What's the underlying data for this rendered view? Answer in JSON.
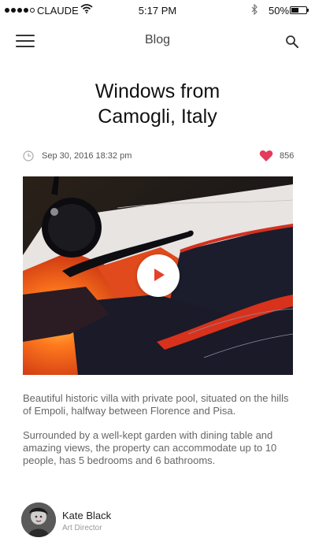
{
  "status_bar": {
    "carrier": "CLAUDE",
    "time": "5:17 PM",
    "battery_percent": "50%",
    "battery_level": 0.5,
    "signal_bars_filled": 4,
    "signal_bars_total": 5,
    "icons": [
      "wifi-icon",
      "bluetooth-icon",
      "battery-icon"
    ]
  },
  "nav": {
    "title": "Blog",
    "menu_icon": "hamburger-menu-icon",
    "search_icon": "search-icon"
  },
  "post": {
    "title_line1": "Windows from",
    "title_line2": "Camogli, Italy",
    "date": "Sep 30, 2016 18:32 pm",
    "likes": "856",
    "paragraph1": "Beautiful historic villa with private pool, situated on the hills of Empoli, halfway between Florence and Pisa.",
    "paragraph2": "Surrounded by a well-kept garden with dining table and amazing views, the property can accommodate up to 10 people, has 5 bedrooms and 6 bathrooms."
  },
  "author": {
    "name": "Kate Black",
    "role": "Art Director"
  },
  "colors": {
    "accent_heart": "#e43b5a",
    "play_icon": "#e4412a",
    "text_muted": "#666666"
  }
}
